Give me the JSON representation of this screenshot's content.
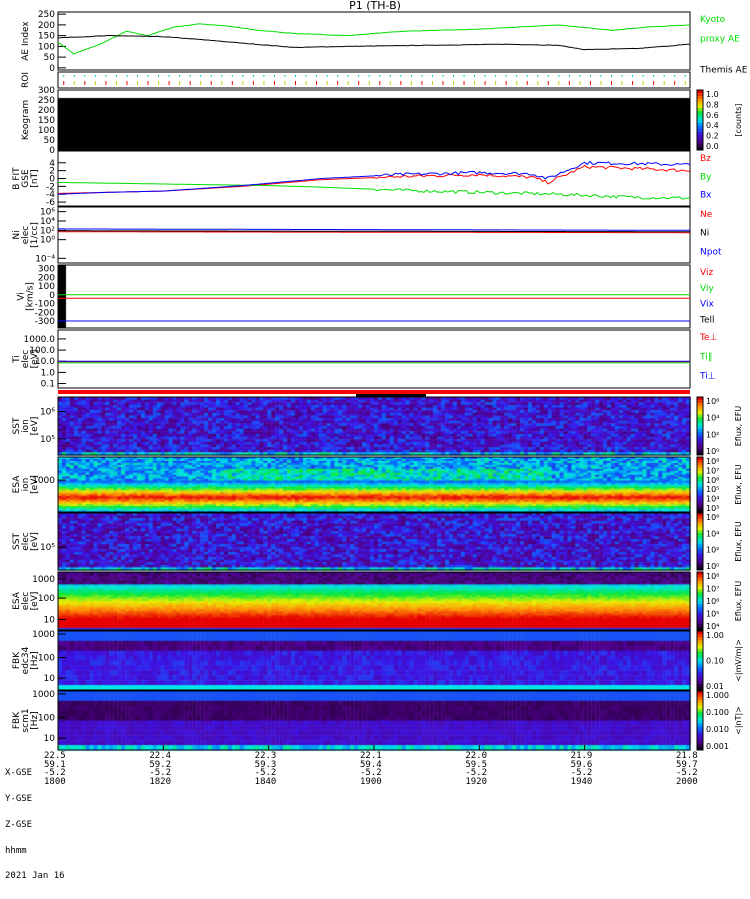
{
  "title": "P1 (TH-B)",
  "colors": {
    "red": "#ff0000",
    "green": "#00dd00",
    "blue": "#0000ff",
    "black": "#000000"
  },
  "chart_data": {
    "type": "line",
    "x_range_minutes": [
      0,
      120
    ],
    "panels": [
      {
        "id": "ae",
        "label": [
          "AE Index"
        ],
        "ylim": [
          -10,
          260
        ],
        "ticks": [
          "250",
          "200",
          "150",
          "100",
          "50",
          "0"
        ],
        "tickvals": [
          250,
          200,
          150,
          100,
          50,
          0
        ],
        "series": [
          {
            "name": "Kyoto proxy AE",
            "color": "#00dd00",
            "x": [
              0,
              3,
              8,
              13,
              17,
              22,
              27,
              32,
              38,
              45,
              55,
              65,
              80,
              95,
              105,
              112,
              120
            ],
            "y": [
              120,
              65,
              110,
              170,
              150,
              190,
              205,
              195,
              175,
              160,
              150,
              170,
              180,
              200,
              175,
              190,
              200
            ]
          },
          {
            "name": "Themis AE",
            "color": "#000000",
            "x": [
              0,
              10,
              20,
              28,
              35,
              45,
              55,
              70,
              85,
              95,
              100,
              110,
              120
            ],
            "y": [
              140,
              150,
              145,
              130,
              115,
              95,
              100,
              105,
              110,
              105,
              85,
              90,
              110
            ]
          }
        ],
        "legend": [
          {
            "text": "Kyoto",
            "color": "#00dd00"
          },
          {
            "text": "proxy AE",
            "color": "#00dd00"
          },
          {
            "text": "Themis AE",
            "color": "#000000"
          }
        ]
      },
      {
        "id": "roi",
        "label": [
          "ROI"
        ],
        "ticks": [],
        "tickvals": []
      },
      {
        "id": "keo",
        "label": [
          "Keogram"
        ],
        "ylim": [
          0,
          300
        ],
        "ticks": [
          "300",
          "250",
          "200",
          "150",
          "100",
          "50",
          "0"
        ],
        "tickvals": [
          300,
          250,
          200,
          150,
          100,
          50,
          0
        ],
        "colorbar": {
          "ticks": [
            "1.0",
            "0.8",
            "0.6",
            "0.4",
            "0.2",
            "0.0"
          ],
          "label": "[counts]"
        }
      },
      {
        "id": "b",
        "label": [
          "B FIT",
          "GSE",
          "[nT]"
        ],
        "ylim": [
          -7,
          7
        ],
        "ticks": [
          "4",
          "2",
          "0",
          "-2",
          "-4",
          "-6"
        ],
        "tickvals": [
          4,
          2,
          0,
          -2,
          -4,
          -6
        ],
        "series": [
          {
            "name": "Bz",
            "color": "#ff0000",
            "x": [
              0,
              10,
              20,
              35,
              50,
              65,
              80,
              90,
              93,
              100,
              110,
              120
            ],
            "y": [
              -3.8,
              -3.5,
              -3.2,
              -2,
              -0.3,
              0.5,
              1,
              0.3,
              -1,
              3,
              2.5,
              2
            ]
          },
          {
            "name": "By",
            "color": "#00dd00",
            "x": [
              0,
              10,
              25,
              40,
              50,
              65,
              80,
              95,
              110,
              120
            ],
            "y": [
              -1,
              -1.2,
              -1.5,
              -1.8,
              -2.2,
              -3,
              -3.5,
              -4,
              -4.8,
              -5
            ]
          },
          {
            "name": "Bx",
            "color": "#0000ff",
            "x": [
              0,
              10,
              20,
              35,
              50,
              65,
              80,
              90,
              93,
              100,
              110,
              120
            ],
            "y": [
              -4,
              -3.5,
              -3.2,
              -1.8,
              0,
              1,
              1.5,
              1.2,
              0,
              4,
              3.8,
              3.5
            ]
          }
        ],
        "legend": [
          {
            "text": "Bz",
            "color": "#ff0000"
          },
          {
            "text": "By",
            "color": "#00dd00"
          },
          {
            "text": "Bx",
            "color": "#0000ff"
          }
        ]
      },
      {
        "id": "ni",
        "label": [
          "Ni",
          "elec",
          "[1/cc]"
        ],
        "log": true,
        "ylim": [
          -5,
          7
        ],
        "ticks": [
          "10⁶",
          "10⁴",
          "10²",
          "10⁰",
          "10⁻⁴"
        ],
        "tickvals": [
          6,
          4,
          2,
          0,
          -4
        ],
        "series": [
          {
            "name": "Ne",
            "color": "#ff0000",
            "x": [
              0,
              120
            ],
            "y": [
              1.7,
              1.5
            ]
          },
          {
            "name": "Npot",
            "color": "#0000ff",
            "x": [
              0,
              120
            ],
            "y": [
              2.3,
              2.0
            ]
          },
          {
            "name": "Ni",
            "color": "#000000",
            "x": [
              0,
              120
            ],
            "y": [
              1.9,
              1.7
            ]
          }
        ],
        "legend": [
          {
            "text": "Ne",
            "color": "#ff0000"
          },
          {
            "text": "Ni",
            "color": "#000000"
          },
          {
            "text": "Npot",
            "color": "#0000ff"
          }
        ]
      },
      {
        "id": "vi",
        "label": [
          "Vi",
          "[km/s]"
        ],
        "ylim": [
          -380,
          340
        ],
        "ticks": [
          "300",
          "200",
          "100",
          "0",
          "-100",
          "-200",
          "-300"
        ],
        "tickvals": [
          300,
          200,
          100,
          0,
          -100,
          -200,
          -300
        ],
        "series": [
          {
            "name": "Viz",
            "color": "#ff0000",
            "x": [
              0,
              120
            ],
            "y": [
              -40,
              -40
            ]
          },
          {
            "name": "Viy",
            "color": "#00dd00",
            "x": [
              0,
              120
            ],
            "y": [
              0,
              0
            ]
          },
          {
            "name": "Vix",
            "color": "#0000ff",
            "x": [
              0,
              120
            ],
            "y": [
              -300,
              -300
            ]
          }
        ],
        "legend": [
          {
            "text": "Viz",
            "color": "#ff0000"
          },
          {
            "text": "Viy",
            "color": "#00dd00"
          },
          {
            "text": "Vix",
            "color": "#0000ff"
          },
          {
            "text": "Tell",
            "color": "#000000"
          }
        ]
      },
      {
        "id": "t",
        "label": [
          "Ti",
          "elec",
          "[eV]"
        ],
        "log": true,
        "ylim": [
          -1.4,
          3.8
        ],
        "ticks": [
          "1000.0",
          "100.0",
          "10.0",
          "1.0",
          "0.1"
        ],
        "tickvals": [
          3,
          2,
          1,
          0,
          -1
        ],
        "series": [
          {
            "name": "Te⊥",
            "color": "#ff0000",
            "x": [
              0,
              120
            ],
            "y": [
              0.95,
              0.95
            ]
          },
          {
            "name": "Ti∥",
            "color": "#00dd00",
            "x": [
              0,
              120
            ],
            "y": [
              0.85,
              0.85
            ]
          },
          {
            "name": "Ti⊥",
            "color": "#0000ff",
            "x": [
              0,
              120
            ],
            "y": [
              1.0,
              1.0
            ]
          }
        ],
        "legend": [
          {
            "text": "Te⊥",
            "color": "#ff0000"
          },
          {
            "text": "Ti∥",
            "color": "#00dd00"
          },
          {
            "text": "Ti⊥",
            "color": "#0000ff"
          }
        ]
      },
      {
        "id": "sst_i",
        "label": [
          "SST",
          "ion",
          "[eV]"
        ],
        "ticks": [
          "10⁶",
          "10⁵"
        ],
        "tickpos": [
          0.25,
          0.72
        ],
        "colorbar": {
          "ticks": [
            "10⁶",
            "10⁴",
            "10²",
            "10⁰"
          ],
          "label": "Eflux, EFU"
        },
        "profile": "sst"
      },
      {
        "id": "esa_i",
        "label": [
          "ESA",
          "ion",
          "[eV]"
        ],
        "ticks": [
          "1000"
        ],
        "tickpos": [
          0.42
        ],
        "colorbar": {
          "ticks": [
            "10⁸",
            "10⁷",
            "10⁶",
            "10⁵",
            "10⁴",
            "10³"
          ],
          "label": "Eflux, EFU"
        },
        "profile": "esai"
      },
      {
        "id": "sst_e",
        "label": [
          "SST",
          "elec",
          "[eV]"
        ],
        "ticks": [
          "10⁵"
        ],
        "tickpos": [
          0.6
        ],
        "colorbar": {
          "ticks": [
            "10⁶",
            "10⁴",
            "10²",
            "10⁰"
          ],
          "label": "Eflux, EFU"
        },
        "profile": "sst"
      },
      {
        "id": "esa_e",
        "label": [
          "ESA",
          "elec",
          "[eV]"
        ],
        "ticks": [
          "1000",
          "100",
          "10"
        ],
        "tickpos": [
          0.12,
          0.45,
          0.82
        ],
        "colorbar": {
          "ticks": [
            "10⁸",
            "10⁷",
            "10⁶",
            "10⁵",
            "10⁴"
          ],
          "label": "Eflux, EFU"
        },
        "profile": "esae"
      },
      {
        "id": "fbk1",
        "label": [
          "FBK",
          "edc34",
          "[Hz]"
        ],
        "ticks": [
          "1000",
          "100",
          "10"
        ],
        "tickpos": [
          0.05,
          0.45,
          0.8
        ],
        "colorbar": {
          "ticks": [
            "1.00",
            "0.10",
            "0.01"
          ],
          "label": "<|mV/m|>"
        },
        "profile": "fbk1"
      },
      {
        "id": "fbk2",
        "label": [
          "FBK",
          "scm1",
          "[Hz]"
        ],
        "ticks": [
          "1000",
          "100",
          "10"
        ],
        "tickpos": [
          0.05,
          0.45,
          0.8
        ],
        "colorbar": {
          "ticks": [
            "1.000",
            "0.100",
            "0.010",
            "0.001"
          ],
          "label": "<|nT|>"
        },
        "profile": "fbk2"
      }
    ],
    "x_axis": {
      "row_labels": [
        "X-GSE",
        "Y-GSE",
        "Z-GSE",
        "hhmm"
      ],
      "date": "2021 Jan 16",
      "ticks": [
        {
          "x": "22.5",
          "y": "59.1",
          "z": "-5.2",
          "t": "1800"
        },
        {
          "x": "22.4",
          "y": "59.2",
          "z": "-5.2",
          "t": "1820"
        },
        {
          "x": "22.3",
          "y": "59.3",
          "z": "-5.2",
          "t": "1840"
        },
        {
          "x": "22.1",
          "y": "59.4",
          "z": "-5.2",
          "t": "1900"
        },
        {
          "x": "22.0",
          "y": "59.5",
          "z": "-5.2",
          "t": "1920"
        },
        {
          "x": "21.9",
          "y": "59.6",
          "z": "-5.2",
          "t": "1940"
        },
        {
          "x": "21.8",
          "y": "59.7",
          "z": "-5.2",
          "t": "2000"
        }
      ]
    }
  }
}
